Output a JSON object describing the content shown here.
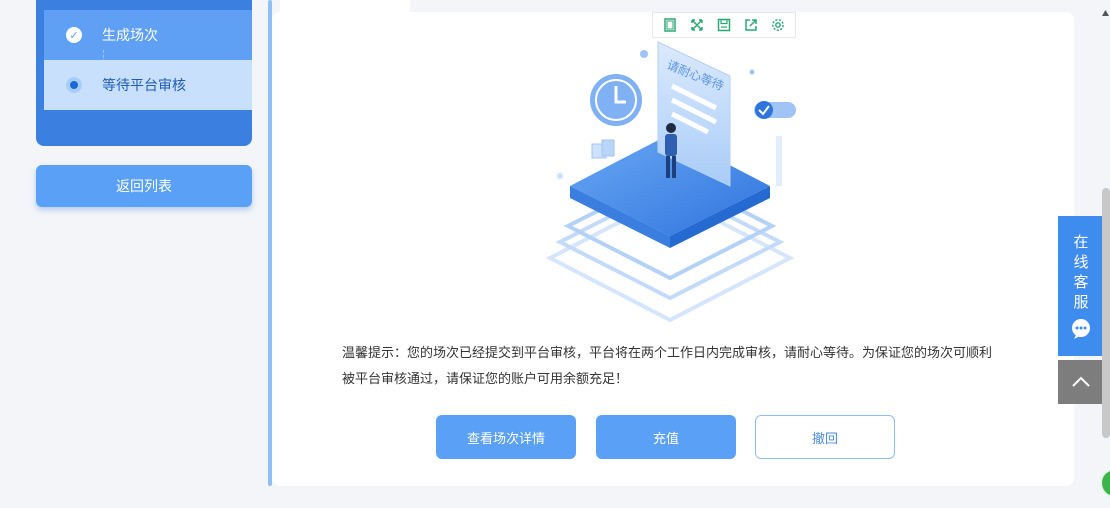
{
  "sidebar": {
    "steps": [
      {
        "label": "生成场次",
        "state": "done"
      },
      {
        "label": "等待平台审核",
        "state": "current"
      }
    ],
    "back_label": "返回列表"
  },
  "toolbar": {
    "icons": [
      "crop-icon",
      "fullscreen-icon",
      "save-icon",
      "share-icon",
      "settings-icon"
    ]
  },
  "illustration": {
    "caption": "请耐心等待"
  },
  "notice": {
    "text": "温馨提示：您的场次已经提交到平台审核，平台将在两个工作日内完成审核，请耐心等待。为保证您的场次可顺利被平台审核通过，请保证您的账户可用余额充足！"
  },
  "actions": {
    "detail_label": "查看场次详情",
    "recharge_label": "充值",
    "revoke_label": "撤回"
  },
  "customer_service": {
    "chars": [
      "在",
      "线",
      "客",
      "服"
    ]
  },
  "colors": {
    "primary": "#5aa0f6",
    "panel": "#3b80e0",
    "background": "#f3f5f8"
  }
}
